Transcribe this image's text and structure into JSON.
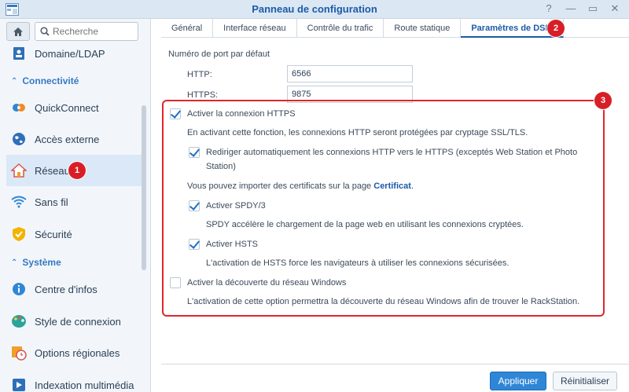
{
  "window": {
    "title": "Panneau de configuration",
    "controls": [
      "?",
      "—",
      "▭",
      "✕"
    ]
  },
  "sidebar": {
    "search_placeholder": "Recherche",
    "items": [
      {
        "label": "Domaine/LDAP",
        "icon": "domain-ldap-icon"
      },
      {
        "label": "QuickConnect",
        "icon": "quickconnect-icon"
      },
      {
        "label": "Accès externe",
        "icon": "globe-icon"
      },
      {
        "label": "Réseau",
        "icon": "network-house-icon",
        "active": true
      },
      {
        "label": "Sans fil",
        "icon": "wifi-icon"
      },
      {
        "label": "Sécurité",
        "icon": "shield-icon"
      },
      {
        "label": "Centre d'infos",
        "icon": "info-icon"
      },
      {
        "label": "Style de connexion",
        "icon": "palette-icon"
      },
      {
        "label": "Options régionales",
        "icon": "regional-clock-icon"
      },
      {
        "label": "Indexation multimédia",
        "icon": "media-index-icon"
      }
    ],
    "sections": [
      "Connectivité",
      "Système"
    ]
  },
  "tabs": [
    "Général",
    "Interface réseau",
    "Contrôle du trafic",
    "Route statique",
    "Paramètres de DSM"
  ],
  "ports": {
    "heading": "Numéro de port par défaut",
    "http_label": "HTTP:",
    "http_value": "6566",
    "https_label": "HTTPS:",
    "https_value": "9875"
  },
  "options": {
    "https_enable": "Activer la connexion HTTPS",
    "https_desc": "En activant cette fonction, les connexions HTTP seront protégées par cryptage SSL/TLS.",
    "redirect_line1": "Rediriger automatiquement les connexions HTTP vers le HTTPS (exceptés Web Station et Photo",
    "redirect_line2": "Station)",
    "cert_prefix": "Vous pouvez importer des certificats sur la page",
    "cert_link": "Certificat",
    "cert_suffix": ".",
    "spdy": "Activer SPDY/3",
    "spdy_desc": "SPDY accélère le chargement de la page web en utilisant les connexions cryptées.",
    "hsts": "Activer HSTS",
    "hsts_desc": "L'activation de HSTS force les navigateurs à utiliser les connexions sécurisées.",
    "windows_discovery": "Activer la découverte du réseau Windows",
    "windows_desc": "L'activation de cette option permettra la découverte du réseau Windows afin de trouver le RackStation."
  },
  "badges": [
    "1",
    "2",
    "3"
  ],
  "buttons": {
    "apply": "Appliquer",
    "reset": "Réinitialiser"
  },
  "colors": {
    "accent": "#1c5aa8",
    "annotation": "#e0262b"
  }
}
